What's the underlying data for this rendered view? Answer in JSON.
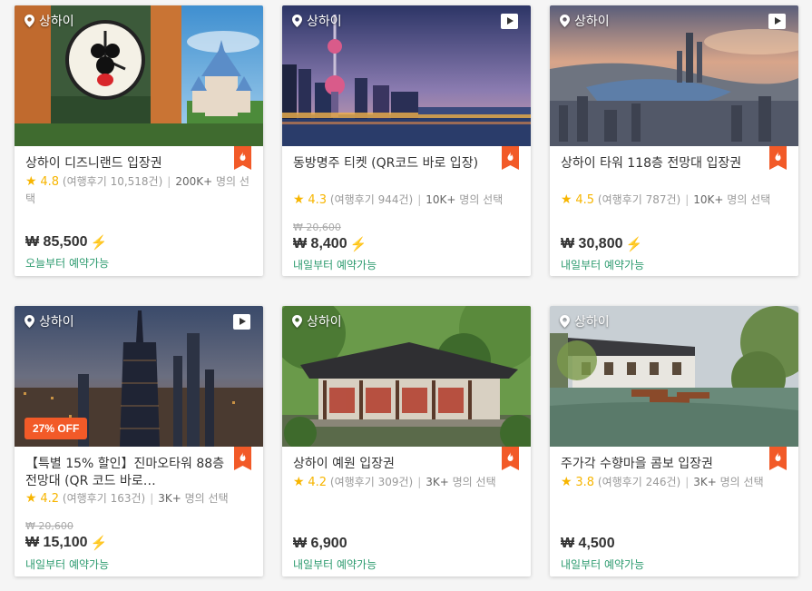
{
  "cards": [
    {
      "location": "상하이",
      "has_video": false,
      "discount": "",
      "title": "상하이 디즈니랜드 입장권",
      "rating": "4.8",
      "reviews": "(여행후기 10,518건)",
      "bookings_count": "200K+",
      "bookings_suffix": "명의 선택",
      "old_price": "",
      "price": "₩ 85,500",
      "instant": true,
      "availability": "오늘부터 예약가능"
    },
    {
      "location": "상하이",
      "has_video": true,
      "discount": "",
      "title": "동방명주 티켓 (QR코드 바로 입장)",
      "rating": "4.3",
      "reviews": "(여행후기 944건)",
      "bookings_count": "10K+",
      "bookings_suffix": "명의 선택",
      "old_price": "₩ 20,600",
      "price": "₩ 8,400",
      "instant": true,
      "availability": "내일부터 예약가능"
    },
    {
      "location": "상하이",
      "has_video": true,
      "discount": "",
      "title": "상하이 타워 118층 전망대 입장권",
      "rating": "4.5",
      "reviews": "(여행후기 787건)",
      "bookings_count": "10K+",
      "bookings_suffix": "명의 선택",
      "old_price": "",
      "price": "₩ 30,800",
      "instant": true,
      "availability": "내일부터 예약가능"
    },
    {
      "location": "상하이",
      "has_video": true,
      "discount": "27% OFF",
      "title": "【특별 15% 할인】진마오타워 88층 전망대 (QR 코드 바로…",
      "rating": "4.2",
      "reviews": "(여행후기 163건)",
      "bookings_count": "3K+",
      "bookings_suffix": "명의 선택",
      "old_price": "₩ 20,600",
      "price": "₩ 15,100",
      "instant": true,
      "availability": "내일부터 예약가능"
    },
    {
      "location": "상하이",
      "has_video": false,
      "discount": "",
      "title": "상하이 예원 입장권",
      "rating": "4.2",
      "reviews": "(여행후기 309건)",
      "bookings_count": "3K+",
      "bookings_suffix": "명의 선택",
      "old_price": "",
      "price": "₩ 6,900",
      "instant": false,
      "availability": "내일부터 예약가능"
    },
    {
      "location": "상하이",
      "has_video": false,
      "discount": "",
      "title": "주가각 수향마을 콤보 입장권",
      "rating": "3.8",
      "reviews": "(여행후기 246건)",
      "bookings_count": "3K+",
      "bookings_suffix": "명의 선택",
      "old_price": "",
      "price": "₩ 4,500",
      "instant": false,
      "availability": "내일부터 예약가능"
    }
  ],
  "colors": {
    "accent": "#f25a28",
    "star": "#f7b500",
    "availability": "#2b9a6e",
    "text": "#333333"
  },
  "icons": {
    "location": "map-pin-icon",
    "video": "play-icon",
    "hot": "fire-badge-icon",
    "star": "star-icon",
    "instant": "lightning-icon"
  }
}
